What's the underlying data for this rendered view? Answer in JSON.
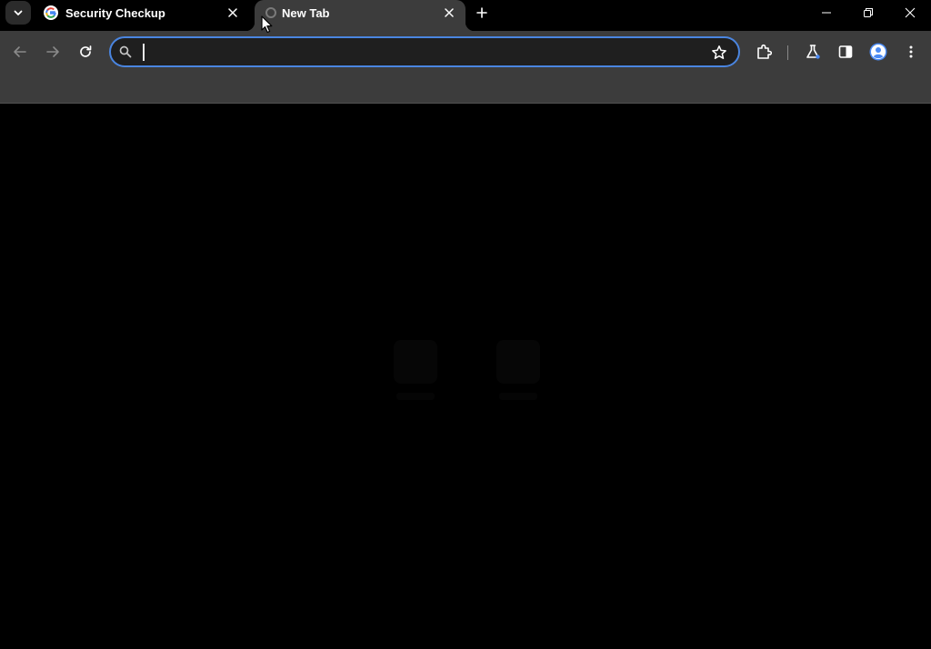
{
  "tabs": [
    {
      "title": "Security Checkup",
      "favicon": "google-icon",
      "active": false
    },
    {
      "title": "New Tab",
      "favicon": "loading-icon",
      "active": true
    }
  ],
  "toolbar": {
    "omnibox": {
      "value": "",
      "placeholder": ""
    },
    "icons": [
      "back-arrow-icon",
      "forward-arrow-icon",
      "reload-icon",
      "search-icon",
      "star-icon",
      "extensions-icon",
      "labs-icon",
      "side-panel-icon",
      "profile-icon",
      "menu-icon"
    ]
  },
  "window_controls": [
    "minimize-icon",
    "restore-icon",
    "close-icon"
  ],
  "colors": {
    "frame": "#000000",
    "toolbar": "#3c3c3c",
    "omnibox_border": "#4a85e0",
    "profile_accent": "#4a8af4"
  }
}
